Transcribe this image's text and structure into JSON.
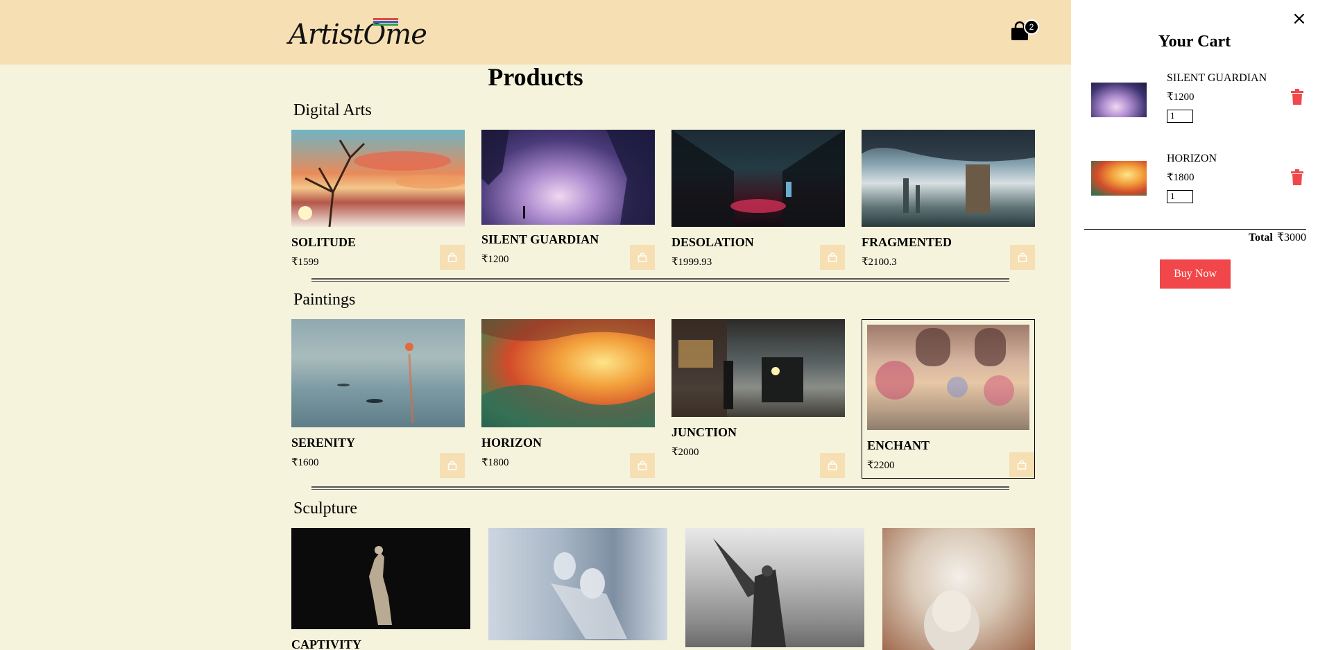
{
  "header": {
    "logo_text": "ArtistOme",
    "cart_count": "2",
    "logo_stripe_colors": [
      "#e14b3a",
      "#3a5bd1",
      "#33a04a",
      "#d9a522"
    ]
  },
  "products": {
    "title": "Products",
    "categories": [
      {
        "name": "Digital Arts",
        "items": [
          {
            "name": "SOLITUDE",
            "price": "₹1599"
          },
          {
            "name": "SILENT GUARDIAN",
            "price": "₹1200"
          },
          {
            "name": "DESOLATION",
            "price": "₹1999.93"
          },
          {
            "name": "FRAGMENTED",
            "price": "₹2100.3"
          }
        ]
      },
      {
        "name": "Paintings",
        "items": [
          {
            "name": "SERENITY",
            "price": "₹1600"
          },
          {
            "name": "HORIZON",
            "price": "₹1800"
          },
          {
            "name": "JUNCTION",
            "price": "₹2000"
          },
          {
            "name": "ENCHANT",
            "price": "₹2200"
          }
        ]
      },
      {
        "name": "Sculpture",
        "items": [
          {
            "name": "CAPTIVITY",
            "price": ""
          }
        ]
      }
    ]
  },
  "cart": {
    "title": "Your Cart",
    "close_icon": "×",
    "items": [
      {
        "name": "SILENT GUARDIAN",
        "price": "₹1200",
        "qty": "1"
      },
      {
        "name": "HORIZON",
        "price": "₹1800",
        "qty": "1"
      }
    ],
    "total_label": "Total",
    "total_value": "₹3000",
    "buy_label": "Buy Now"
  },
  "colors": {
    "page_bg": "#f5f3dc",
    "header_bg": "#f6dfb3",
    "buy_button": "#f2474a",
    "trash": "#f2474a"
  }
}
